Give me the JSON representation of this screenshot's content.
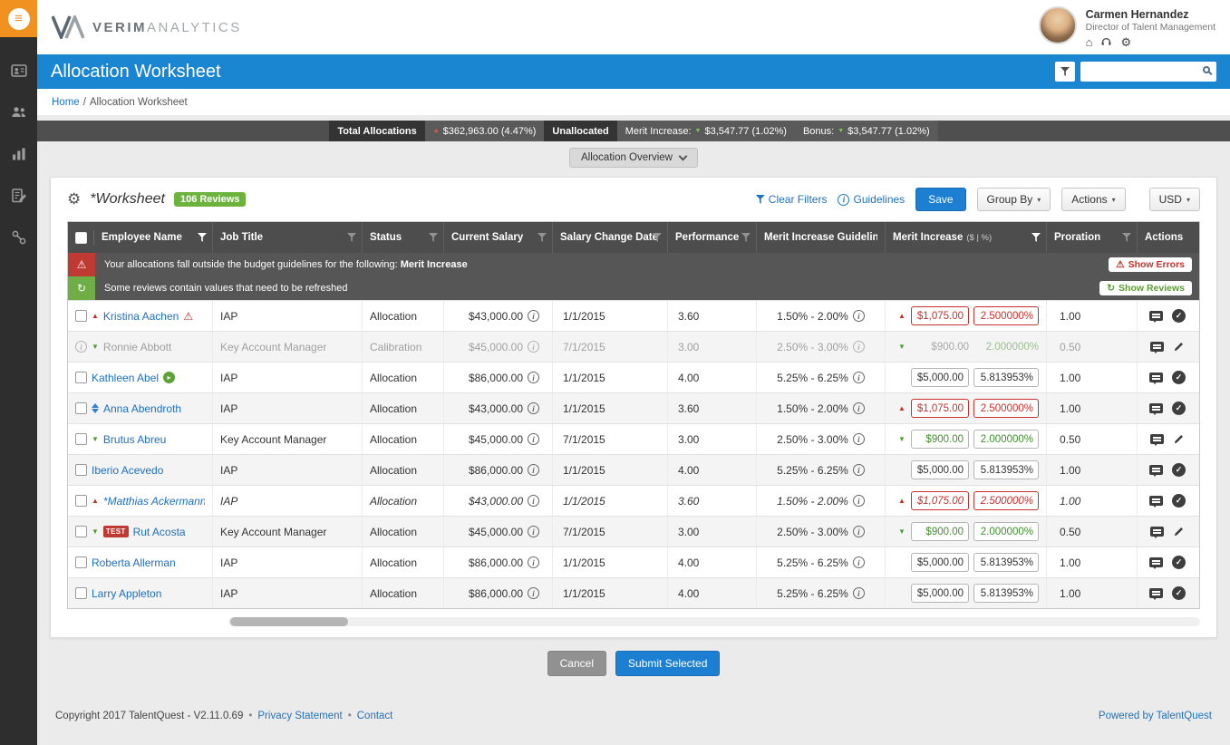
{
  "icons": {
    "hamburger": "≡",
    "gear": "⚙",
    "home": "⌂",
    "warning": "⚠",
    "info": "i",
    "refresh": "↻",
    "check": "✓",
    "triangle_up": "▲",
    "triangle_down": "▼",
    "caret_down": "▾",
    "arrow_right": "▸",
    "bullet": "•"
  },
  "sidebar": {
    "items": [
      "employees",
      "people",
      "analytics",
      "worksheet",
      "relations"
    ]
  },
  "brand": {
    "bold": "VERIM",
    "light": "ANALYTICS"
  },
  "user": {
    "name": "Carmen Hernandez",
    "title": "Director of Talent Management"
  },
  "page": {
    "title": "Allocation Worksheet"
  },
  "breadcrumb": {
    "home": "Home",
    "separator": "/",
    "current": "Allocation Worksheet"
  },
  "summary": {
    "total_label": "Total Allocations",
    "total_value": "$362,963.00 (4.47%)",
    "unallocated_label": "Unallocated",
    "merit_label": "Merit Increase:",
    "merit_value": "$3,547.77 (1.02%)",
    "bonus_label": "Bonus:",
    "bonus_value": "$3,547.77 (1.02%)"
  },
  "overview": {
    "label": "Allocation Overview"
  },
  "toolbar": {
    "title": "*Worksheet",
    "reviews_badge": "106 Reviews",
    "clear_filters": "Clear Filters",
    "guidelines": "Guidelines",
    "save": "Save",
    "group_by": "Group By",
    "actions": "Actions",
    "currency": "USD"
  },
  "banners": {
    "error": {
      "text": "Your allocations fall outside the budget guidelines for the following:",
      "highlight": "Merit Increase",
      "action": "Show Errors"
    },
    "refresh": {
      "text": "Some reviews contain values that need to be refreshed",
      "action": "Show Reviews"
    }
  },
  "table": {
    "test_badge_label": "TEST",
    "columns": [
      {
        "key": "name",
        "label": "Employee Name",
        "filter": "active"
      },
      {
        "key": "job",
        "label": "Job Title",
        "filter": "normal"
      },
      {
        "key": "status",
        "label": "Status",
        "filter": "normal"
      },
      {
        "key": "salary",
        "label": "Current Salary",
        "filter": "normal"
      },
      {
        "key": "date",
        "label": "Salary Change Date",
        "filter": "normal"
      },
      {
        "key": "perf",
        "label": "Performance",
        "filter": "normal"
      },
      {
        "key": "guide",
        "label": "Merit Increase Guidelines",
        "filter": "none"
      },
      {
        "key": "merit",
        "label": "Merit Increase",
        "sub": "($ | %)",
        "filter": "active"
      },
      {
        "key": "pror",
        "label": "Proration",
        "filter": "normal"
      },
      {
        "key": "actions",
        "label": "Actions",
        "filter": "none"
      }
    ],
    "rows": [
      {
        "select": "checkbox",
        "pre_icons": [
          "triangle-up-red"
        ],
        "name": "Kristina Aachen",
        "post_icons": [
          "warning-red"
        ],
        "badge": null,
        "job_title": "IAP",
        "status": "Allocation",
        "current_salary": "$43,000.00",
        "salary_change_date": "1/1/2015",
        "performance": "3.60",
        "guidelines": "1.50% - 2.00%",
        "merit_arrow": "up-red",
        "merit_amount": "$1,075.00",
        "merit_pct": "2.500000%",
        "merit_display": "inputs",
        "merit_tone": "error",
        "proration": "1.00",
        "actions": [
          "comment",
          "check-circle"
        ],
        "row_class": ""
      },
      {
        "select": "info",
        "pre_icons": [
          "triangle-down-green"
        ],
        "name": "Ronnie Abbott",
        "post_icons": [],
        "badge": null,
        "job_title": "Key Account Manager",
        "status": "Calibration",
        "current_salary": "$45,000.00",
        "salary_change_date": "7/1/2015",
        "performance": "3.00",
        "guidelines": "2.50% - 3.00%",
        "merit_arrow": "down-green",
        "merit_amount": "$900.00",
        "merit_pct": "2.000000%",
        "merit_display": "text",
        "merit_tone": "muted",
        "proration": "0.50",
        "actions": [
          "comment",
          "pencil"
        ],
        "row_class": "muted"
      },
      {
        "select": "checkbox",
        "pre_icons": [],
        "name": "Kathleen Abel",
        "post_icons": [
          "sent-green"
        ],
        "badge": null,
        "job_title": "IAP",
        "status": "Allocation",
        "current_salary": "$86,000.00",
        "salary_change_date": "1/1/2015",
        "performance": "4.00",
        "guidelines": "5.25% - 6.25%",
        "merit_arrow": "none",
        "merit_amount": "$5,000.00",
        "merit_pct": "5.813953%",
        "merit_display": "inputs",
        "merit_tone": "normal",
        "proration": "1.00",
        "actions": [
          "comment",
          "check-circle"
        ],
        "row_class": ""
      },
      {
        "select": "checkbox",
        "pre_icons": [
          "sort-blue"
        ],
        "name": "Anna Abendroth",
        "post_icons": [],
        "badge": null,
        "job_title": "IAP",
        "status": "Allocation",
        "current_salary": "$43,000.00",
        "salary_change_date": "1/1/2015",
        "performance": "3.60",
        "guidelines": "1.50% - 2.00%",
        "merit_arrow": "up-red",
        "merit_amount": "$1,075.00",
        "merit_pct": "2.500000%",
        "merit_display": "inputs",
        "merit_tone": "error",
        "proration": "1.00",
        "actions": [
          "comment",
          "check-circle"
        ],
        "row_class": ""
      },
      {
        "select": "checkbox",
        "pre_icons": [
          "triangle-down-green"
        ],
        "name": "Brutus Abreu",
        "post_icons": [],
        "badge": null,
        "job_title": "Key Account Manager",
        "status": "Allocation",
        "current_salary": "$45,000.00",
        "salary_change_date": "7/1/2015",
        "performance": "3.00",
        "guidelines": "2.50% - 3.00%",
        "merit_arrow": "down-green",
        "merit_amount": "$900.00",
        "merit_pct": "2.000000%",
        "merit_display": "inputs",
        "merit_tone": "success",
        "proration": "0.50",
        "actions": [
          "comment",
          "pencil"
        ],
        "row_class": ""
      },
      {
        "select": "checkbox",
        "pre_icons": [],
        "name": "Iberio Acevedo",
        "post_icons": [],
        "badge": null,
        "job_title": "IAP",
        "status": "Allocation",
        "current_salary": "$86,000.00",
        "salary_change_date": "1/1/2015",
        "performance": "4.00",
        "guidelines": "5.25% - 6.25%",
        "merit_arrow": "none",
        "merit_amount": "$5,000.00",
        "merit_pct": "5.813953%",
        "merit_display": "inputs",
        "merit_tone": "normal",
        "proration": "1.00",
        "actions": [
          "comment",
          "check-circle"
        ],
        "row_class": ""
      },
      {
        "select": "checkbox",
        "pre_icons": [
          "triangle-up-red"
        ],
        "name": "*Matthias Ackermann",
        "post_icons": [],
        "badge": null,
        "job_title": "IAP",
        "status": "Allocation",
        "current_salary": "$43,000.00",
        "salary_change_date": "1/1/2015",
        "performance": "3.60",
        "guidelines": "1.50% - 2.00%",
        "merit_arrow": "up-red",
        "merit_amount": "$1,075.00",
        "merit_pct": "2.500000%",
        "merit_display": "inputs",
        "merit_tone": "error",
        "proration": "1.00",
        "actions": [
          "comment",
          "check-circle"
        ],
        "row_class": "italic"
      },
      {
        "select": "checkbox",
        "pre_icons": [
          "triangle-down-green"
        ],
        "name": "Rut Acosta",
        "post_icons": [],
        "badge": "TEST",
        "job_title": "Key Account Manager",
        "status": "Allocation",
        "current_salary": "$45,000.00",
        "salary_change_date": "7/1/2015",
        "performance": "3.00",
        "guidelines": "2.50% - 3.00%",
        "merit_arrow": "down-green",
        "merit_amount": "$900.00",
        "merit_pct": "2.000000%",
        "merit_display": "inputs",
        "merit_tone": "success",
        "proration": "0.50",
        "actions": [
          "comment",
          "pencil"
        ],
        "row_class": ""
      },
      {
        "select": "checkbox",
        "pre_icons": [],
        "name": "Roberta Allerman",
        "post_icons": [],
        "badge": null,
        "job_title": "IAP",
        "status": "Allocation",
        "current_salary": "$86,000.00",
        "salary_change_date": "1/1/2015",
        "performance": "4.00",
        "guidelines": "5.25% - 6.25%",
        "merit_arrow": "none",
        "merit_amount": "$5,000.00",
        "merit_pct": "5.813953%",
        "merit_display": "inputs",
        "merit_tone": "normal",
        "proration": "1.00",
        "actions": [
          "comment",
          "check-circle"
        ],
        "row_class": ""
      },
      {
        "select": "checkbox",
        "pre_icons": [],
        "name": "Larry Appleton",
        "post_icons": [],
        "badge": null,
        "job_title": "IAP",
        "status": "Allocation",
        "current_salary": "$86,000.00",
        "salary_change_date": "1/1/2015",
        "performance": "4.00",
        "guidelines": "5.25% - 6.25%",
        "merit_arrow": "none",
        "merit_amount": "$5,000.00",
        "merit_pct": "5.813953%",
        "merit_display": "inputs",
        "merit_tone": "normal",
        "proration": "1.00",
        "actions": [
          "comment",
          "check-circle"
        ],
        "row_class": ""
      }
    ]
  },
  "buttons": {
    "cancel": "Cancel",
    "submit": "Submit Selected"
  },
  "footer": {
    "copyright": "Copyright 2017 TalentQuest - V2.11.0.69",
    "privacy": "Privacy Statement",
    "contact": "Contact",
    "powered": "Powered by TalentQuest"
  }
}
